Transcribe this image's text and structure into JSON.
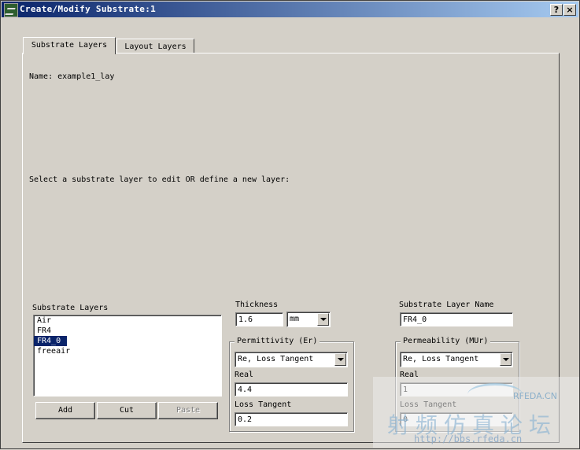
{
  "window": {
    "title": "Create/Modify Substrate:1",
    "help_glyph": "?",
    "close_glyph": "×"
  },
  "tabs": [
    {
      "label": "Substrate Layers",
      "active": true
    },
    {
      "label": "Layout Layers",
      "active": false
    }
  ],
  "panel": {
    "name_line": "Name: example1_lay",
    "instruction": "Select a substrate layer to edit OR define a new layer:"
  },
  "substrate_list": {
    "label": "Substrate Layers",
    "items": [
      "Air",
      "FR4",
      "FR4_0",
      "freeair"
    ],
    "selected": "FR4_0"
  },
  "buttons": {
    "add": "Add",
    "cut": "Cut",
    "paste": "Paste"
  },
  "thickness": {
    "label": "Thickness",
    "value": "1.6",
    "unit": "mm"
  },
  "layer_name": {
    "label": "Substrate Layer Name",
    "value": "FR4_0"
  },
  "permittivity": {
    "group_label": "Permittivity (Er)",
    "mode": "Re, Loss Tangent",
    "real_label": "Real",
    "real_value": "4.4",
    "loss_label": "Loss Tangent",
    "loss_value": "0.2"
  },
  "permeability": {
    "group_label": "Permeability (MUr)",
    "mode": "Re, Loss Tangent",
    "real_label": "Real",
    "real_value": "1",
    "loss_label": "Loss Tangent",
    "loss_value": "0"
  },
  "watermark": {
    "brand": "RFEDA.CN",
    "chinese": "射频仿真论坛",
    "url": "http://bbs.rfeda.cn"
  },
  "icons": {
    "app": "app-icon",
    "help": "help-icon",
    "close": "close-icon",
    "dropdown": "chevron-down-icon"
  }
}
